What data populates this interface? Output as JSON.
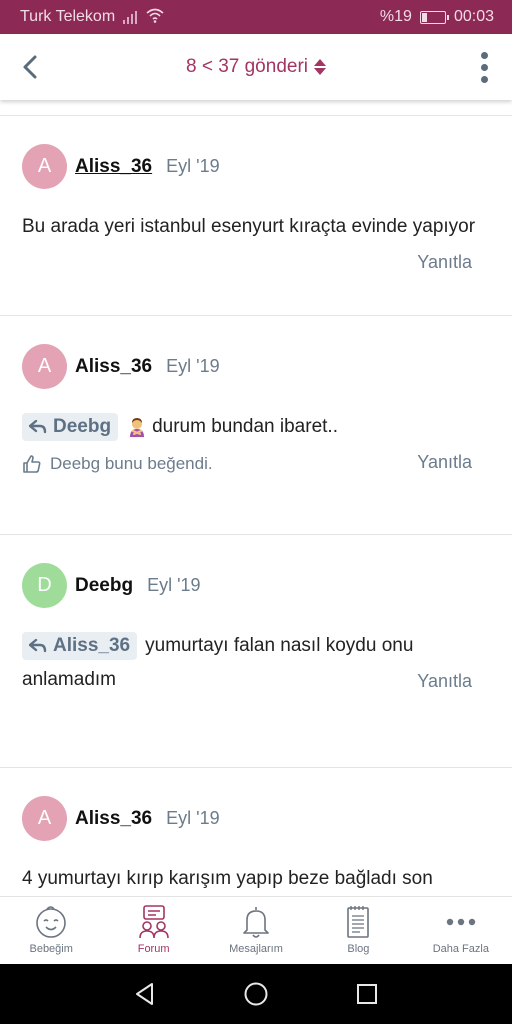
{
  "status_bar": {
    "carrier": "Turk Telekom",
    "battery": "%19",
    "battery_level": 0.19,
    "time": "00:03"
  },
  "header": {
    "pager": "8 < 37 gönderi",
    "icons": {
      "back": "chevron-left-icon",
      "more": "more-vertical-icon",
      "sort": "sort-arrows-icon"
    }
  },
  "colors": {
    "status_bar": "#8c2a55",
    "accent": "#a33563",
    "avatar_pink": "#e3a3b5",
    "avatar_green": "#9fdc9a",
    "meta_text": "#6c7c8c"
  },
  "posts": [
    {
      "avatar_letter": "A",
      "author": "Aliss_36",
      "date": "Eyl '19",
      "text": "Bu arada yeri istanbul esenyurt kıraçta evinde yapıyor",
      "reply_label": "Yanıtla"
    },
    {
      "avatar_letter": "A",
      "author": "Aliss_36",
      "date": "Eyl '19",
      "quote_user": "Deebg",
      "text": "durum bundan ibaret..",
      "like_text": "Deebg bunu beğendi.",
      "reply_label": "Yanıtla"
    },
    {
      "avatar_letter": "D",
      "author": "Deebg",
      "date": "Eyl '19",
      "quote_user": "Aliss_36",
      "text": "yumurtayı falan nasıl koydu onu anlamadım",
      "reply_label": "Yanıtla"
    },
    {
      "avatar_letter": "A",
      "author": "Aliss_36",
      "date": "Eyl '19",
      "text": "4 yumurtayı kırıp karışım yapıp beze bağladı son"
    }
  ],
  "bottom_nav": [
    {
      "label": "Bebeğim",
      "icon": "baby-face-icon"
    },
    {
      "label": "Forum",
      "icon": "forum-people-icon",
      "active": true
    },
    {
      "label": "Mesajlarım",
      "icon": "bell-icon"
    },
    {
      "label": "Blog",
      "icon": "notepad-icon"
    },
    {
      "label": "Daha Fazla",
      "icon": "more-horizontal-icon"
    }
  ]
}
